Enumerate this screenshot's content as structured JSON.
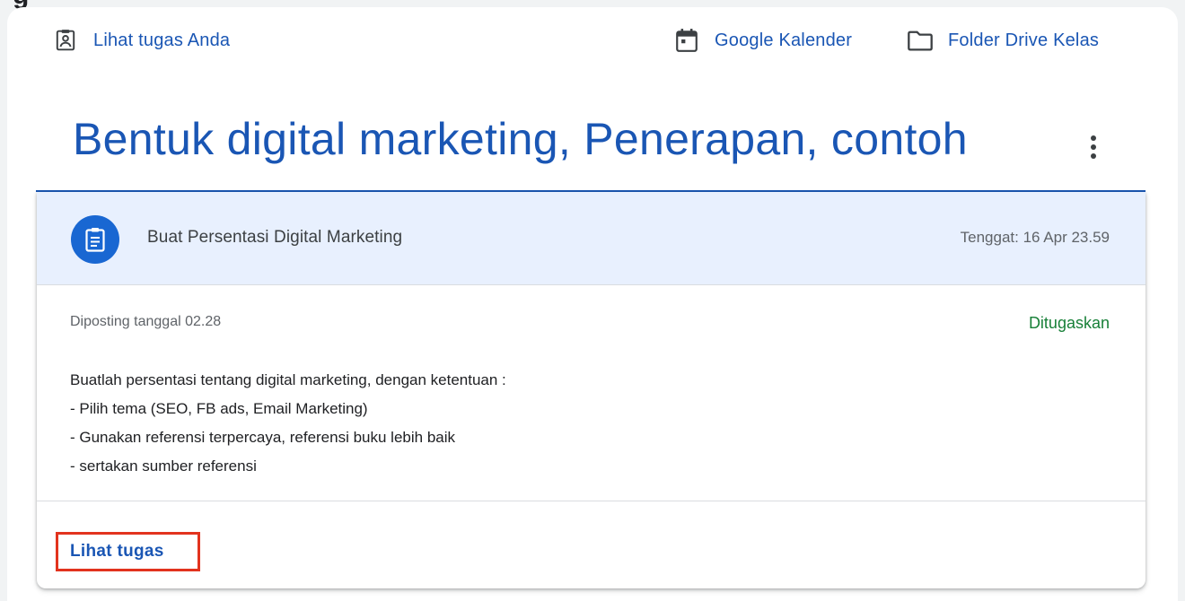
{
  "header_links": {
    "your_work": {
      "label": "Lihat tugas Anda",
      "icon": "assignment-ind-icon"
    },
    "calendar": {
      "label": "Google Kalender",
      "icon": "calendar-icon"
    },
    "drive": {
      "label": "Folder Drive Kelas",
      "icon": "folder-icon"
    }
  },
  "topic": {
    "title": "Bentuk digital marketing, Penerapan, contoh",
    "more_icon": "more-vert-icon"
  },
  "assignment": {
    "icon": "assignment-icon",
    "title": "Buat Persentasi Digital Marketing",
    "due": "Tenggat: 16 Apr 23.59",
    "posted": "Diposting tanggal 02.28",
    "status": "Ditugaskan",
    "description": [
      "Buatlah persentasi tentang digital marketing, dengan ketentuan :",
      "- Pilih tema (SEO, FB ads, Email Marketing)",
      "- Gunakan referensi terpercaya, referensi buku lebih baik",
      "- sertakan sumber referensi"
    ],
    "view_button": "Lihat tugas"
  },
  "colors": {
    "link_blue": "#1a56b4",
    "header_bg": "#e8f0fe",
    "avatar_blue": "#1967d2",
    "status_green": "#188038",
    "highlight_red": "#e2331e"
  }
}
